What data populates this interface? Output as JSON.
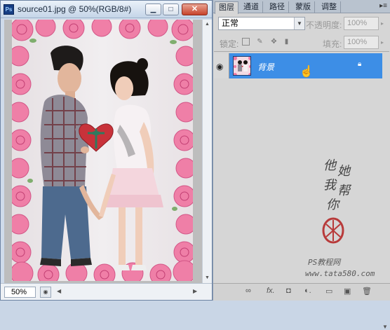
{
  "document": {
    "title": "source01.jpg @ 50%(RGB/8#)",
    "app_badge": "Ps",
    "minimize_glyph": "▁",
    "maximize_glyph": "□",
    "close_glyph": "✕",
    "zoom": "50%",
    "icons": [
      "photoshop-logo-icon",
      "minimize-icon",
      "maximize-icon",
      "close-icon",
      "status-menu-icon",
      "scroll-left-icon",
      "scroll-right-icon",
      "scroll-up-icon",
      "scroll-down-icon"
    ]
  },
  "panel": {
    "tabs": [
      {
        "label": "图层",
        "active": true
      },
      {
        "label": "通道",
        "active": false
      },
      {
        "label": "路径",
        "active": false
      },
      {
        "label": "蒙版",
        "active": false
      },
      {
        "label": "调整",
        "active": false
      }
    ],
    "menu_glyph": "▸≡",
    "blend_mode": "正常",
    "opacity_label": "不透明度:",
    "opacity_value": "100%",
    "lock_label": "锁定:",
    "fill_label": "填充:",
    "fill_value": "100%",
    "layers": [
      {
        "name": "背景",
        "visible": true,
        "locked": true,
        "selected": true
      }
    ],
    "bottom_buttons": [
      "link-layers-icon",
      "fx-icon",
      "add-mask-icon",
      "adjustment-layer-icon",
      "new-group-icon",
      "new-layer-icon",
      "delete-layer-icon"
    ],
    "bottom_labels": {
      "link": "∞",
      "fx": "fx.",
      "mask": "◘",
      "adjust": "◐.",
      "group": "▭",
      "new": "▣",
      "trash": "🗑"
    }
  },
  "watermark": {
    "lines": [
      "他",
      "她",
      "我",
      "帮",
      "你"
    ],
    "site_label": "PS教程网",
    "url": "www.tata580.com",
    "seal_color": "#b83a3a"
  },
  "colors": {
    "selected_layer": "#3d8ee6",
    "panel_bg": "#d6d6d6",
    "rose": "#f07aa4"
  }
}
